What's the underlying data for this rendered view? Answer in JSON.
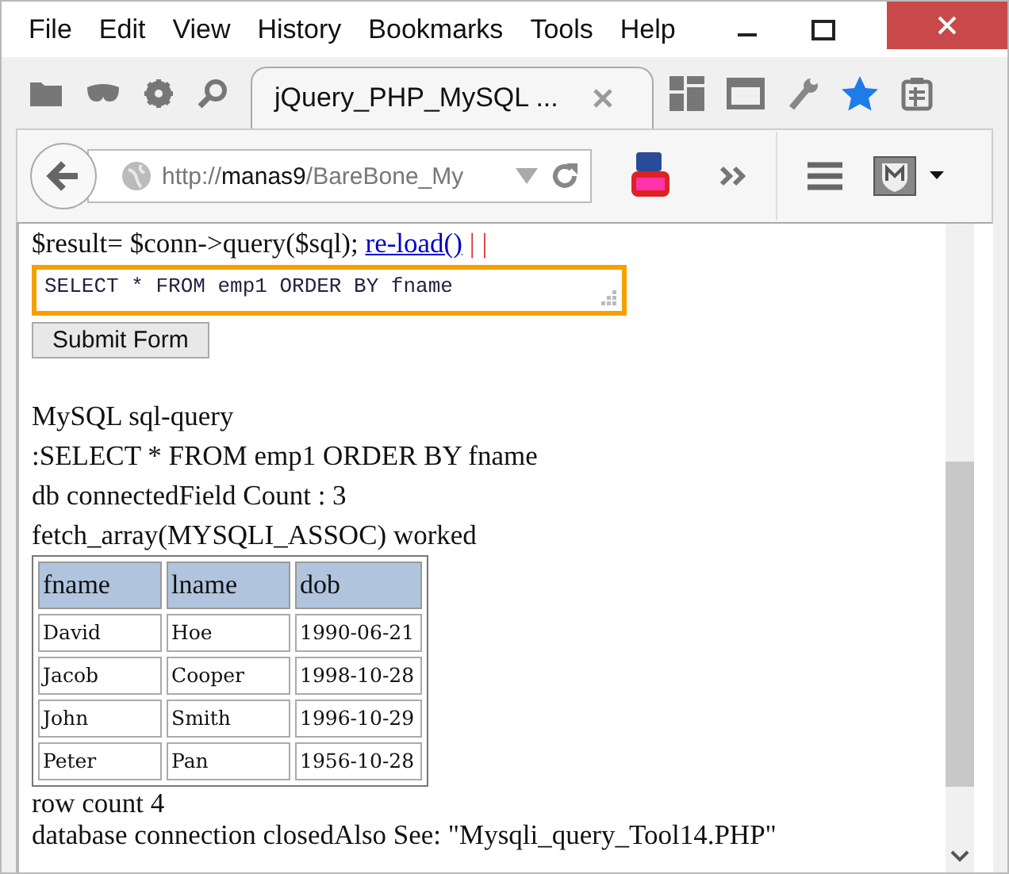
{
  "menu_bar": [
    "File",
    "Edit",
    "View",
    "History",
    "Bookmarks",
    "Tools",
    "Help"
  ],
  "tabs": [
    {
      "title": "jQuery_PHP_MySQL ...",
      "selected": true
    }
  ],
  "address_bar": {
    "scheme": "http://",
    "host": "manas9",
    "path": "/BareBone_My"
  },
  "page": {
    "code_line": "$result= $conn->query($sql);",
    "link": "re-load()",
    "separator": "| |",
    "query_field": {
      "value": "SELECT * FROM emp1 ORDER BY fname",
      "focused": true
    },
    "submit_button": "Submit Form",
    "output_lines": [
      "MySQL sql-query",
      ":SELECT * FROM emp1 ORDER BY fname",
      "db connectedField Count : 3",
      "fetch_array(MYSQLI_ASSOC) worked"
    ],
    "table": {
      "columns": [
        "fname",
        "lname",
        "dob"
      ],
      "rows": [
        [
          "David",
          "Hoe",
          "1990-06-21"
        ],
        [
          "Jacob",
          "Cooper",
          "1998-10-28"
        ],
        [
          "John",
          "Smith",
          "1996-10-29"
        ],
        [
          "Peter",
          "Pan",
          "1956-10-28"
        ]
      ]
    },
    "footer_lines": [
      "row count 4",
      "database connection closedAlso See: \"Mysqli_query_Tool14.PHP\""
    ]
  }
}
